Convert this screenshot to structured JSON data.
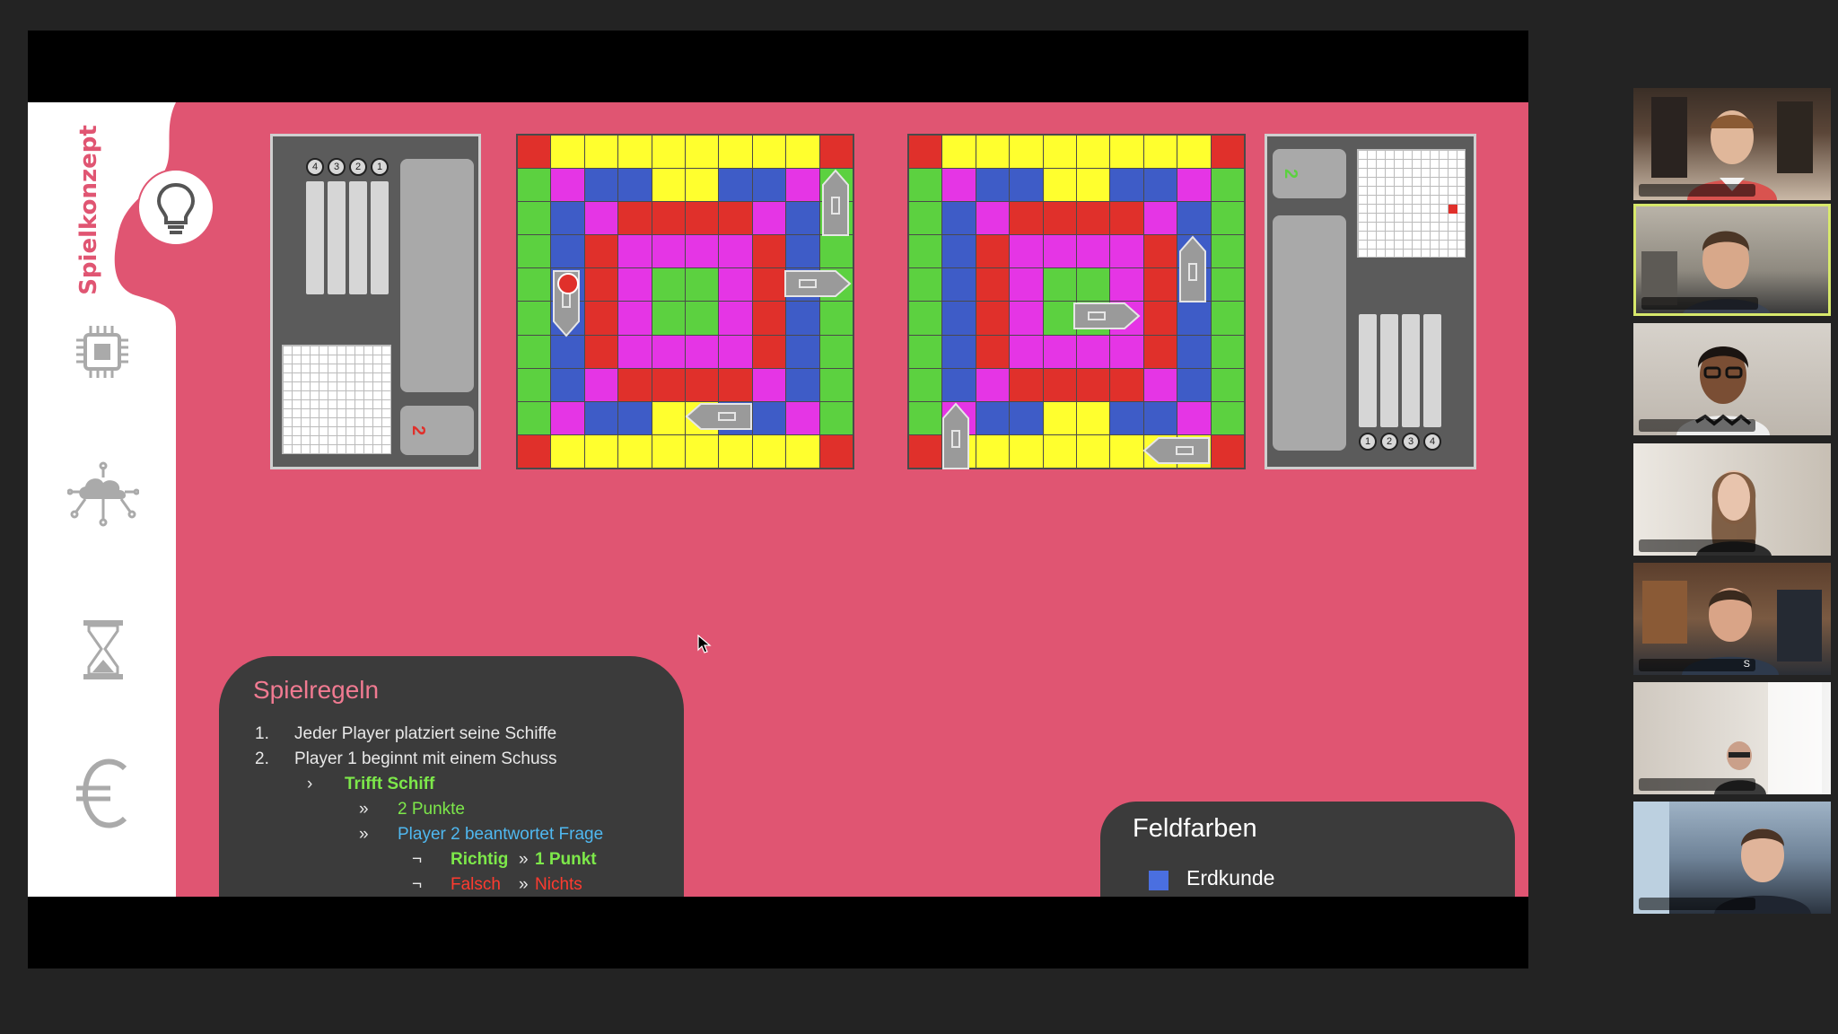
{
  "colors": {
    "slide_bg": "#e05572",
    "panel_dark": "#3b3b3b",
    "board_red": "#e0302b",
    "board_yellow": "#ffff2e",
    "board_green": "#5cd140",
    "board_blue": "#3e5cc7",
    "board_magenta": "#e535e5",
    "erdkunde": "#4a6fe0"
  },
  "sidebar": {
    "title": "Spielkonzept",
    "icons": [
      "lightbulb-icon",
      "chip-icon",
      "cloud-network-icon",
      "hourglass-icon",
      "euro-icon"
    ]
  },
  "left_panel": {
    "top_numbers": [
      "4",
      "3",
      "2",
      "1"
    ],
    "slot_number": "2"
  },
  "right_panel": {
    "top_number": "2",
    "bottom_numbers": [
      "1",
      "2",
      "3",
      "4"
    ]
  },
  "rules": {
    "title": "Spielregeln",
    "item1_num": "1.",
    "item1": "Jeder Player platziert seine Schiffe",
    "item2_num": "2.",
    "item2": "Player 1 beginnt mit einem Schuss",
    "bullet1": "›",
    "hit": "Trifft Schiff",
    "bullet2": "»",
    "points": "2 Punkte",
    "bullet3": "»",
    "answer": "Player 2 beantwortet Frage",
    "dash1": "¬",
    "right": "Richtig",
    "arrow1": "»",
    "right_result": "1 Punkt",
    "dash2": "¬",
    "wrong": "Falsch",
    "arrow2": "»",
    "wrong_result": "Nichts"
  },
  "legend": {
    "title": "Feldfarben",
    "item_label": "Erdkunde"
  },
  "participants": {
    "tile5_name": "S"
  }
}
